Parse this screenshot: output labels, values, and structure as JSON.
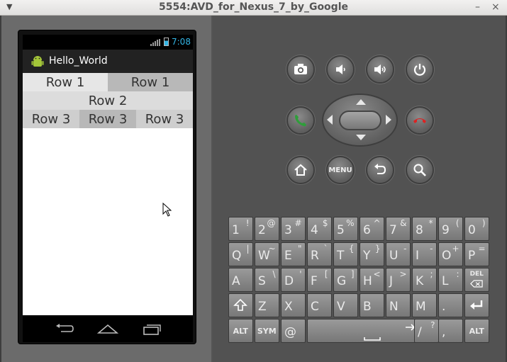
{
  "window": {
    "title": "5554:AVD_for_Nexus_7_by_Google",
    "minimize_glyph": "–",
    "close_glyph": "×"
  },
  "status_bar": {
    "network": "3G",
    "time": "7:08",
    "accent_color": "#33b5e5"
  },
  "app": {
    "title": "Hello_World",
    "rows": [
      [
        "Row 1",
        "Row 1"
      ],
      [
        "Row 2"
      ],
      [
        "Row 3",
        "Row 3",
        "Row 3"
      ]
    ]
  },
  "nav_bar": {
    "buttons": [
      "back-icon",
      "home-icon",
      "recent-apps-icon"
    ]
  },
  "controls": {
    "menu_label": "MENU",
    "buttons": [
      "camera-icon",
      "volume-down-icon",
      "volume-up-icon",
      "power-icon",
      "call-icon",
      "end-call-icon",
      "home-icon",
      "menu-button",
      "back-icon",
      "search-icon"
    ]
  },
  "keyboard": {
    "row1": [
      [
        "1",
        "!"
      ],
      [
        "2",
        "@"
      ],
      [
        "3",
        "#"
      ],
      [
        "4",
        "$"
      ],
      [
        "5",
        "%"
      ],
      [
        "6",
        "^"
      ],
      [
        "7",
        "&"
      ],
      [
        "8",
        "*"
      ],
      [
        "9",
        "("
      ],
      [
        "0",
        ")"
      ]
    ],
    "row2": [
      [
        "Q",
        "|"
      ],
      [
        "W",
        "~"
      ],
      [
        "E",
        "\""
      ],
      [
        "R",
        "`"
      ],
      [
        "T",
        "{"
      ],
      [
        "Y",
        "}"
      ],
      [
        "U",
        "-"
      ],
      [
        "I",
        "-"
      ],
      [
        "O",
        "+"
      ],
      [
        "P",
        "="
      ]
    ],
    "row3": [
      [
        "A",
        ""
      ],
      [
        "S",
        "\\"
      ],
      [
        "D",
        "'"
      ],
      [
        "F",
        "["
      ],
      [
        "G",
        "]"
      ],
      [
        "H",
        "<"
      ],
      [
        "J",
        ">"
      ],
      [
        "K",
        ";"
      ],
      [
        "L",
        ":"
      ]
    ],
    "row4": [
      [
        "Z",
        ""
      ],
      [
        "X",
        ""
      ],
      [
        "C",
        ""
      ],
      [
        "V",
        ""
      ],
      [
        "B",
        ""
      ],
      [
        "N",
        ""
      ],
      [
        "M",
        ""
      ],
      [
        ".",
        ""
      ]
    ],
    "row5": {
      "alt_left": "ALT",
      "sym": "SYM",
      "at": "@",
      "space": "␣",
      "slash": "/",
      "slash_alt": "?",
      "comma": ",",
      "alt_right": "ALT"
    },
    "del_label": "DEL"
  }
}
